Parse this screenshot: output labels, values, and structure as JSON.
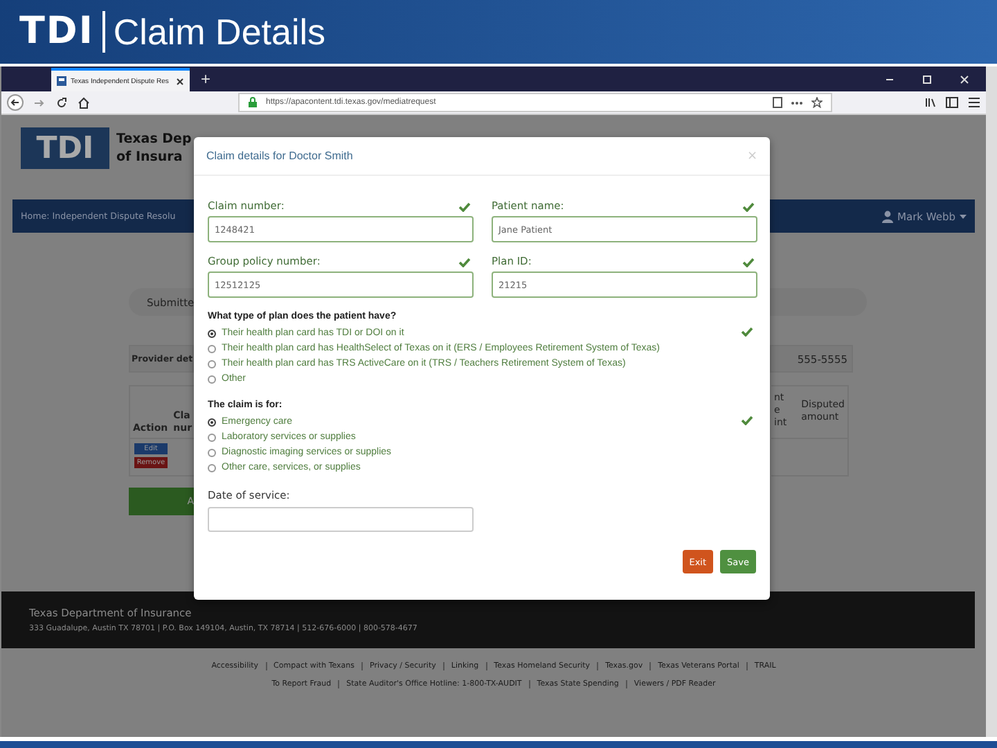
{
  "slide": {
    "logo": "TDI",
    "title": "Claim Details"
  },
  "browser": {
    "tab_title": "Texas Independent Dispute Res",
    "new_tab": "+",
    "url": "https://apacontent.tdi.texas.gov/mediatrequest"
  },
  "page": {
    "logo": "TDI",
    "org_name_lines": [
      "Texas Dep",
      "of Insura"
    ],
    "nav": {
      "breadcrumb": "Home: Independent Dispute Resolu",
      "user": "Mark Webb"
    },
    "submitted_button": "Submitte",
    "provider_label": "Provider det",
    "phone": "555-5555",
    "table": {
      "columns_left": [
        {
          "lines": [
            "Action"
          ]
        },
        {
          "lines": [
            "Cla",
            "nur"
          ]
        }
      ],
      "columns_right": [
        {
          "lines": [
            "nt",
            "e",
            "int"
          ]
        },
        {
          "lines": [
            "Disputed",
            "amount"
          ]
        }
      ],
      "row_buttons": [
        {
          "label": "Edit",
          "kind": "edit"
        },
        {
          "label": "Remove",
          "kind": "remove"
        }
      ]
    },
    "add_button": "A"
  },
  "modal": {
    "title": "Claim details for Doctor Smith",
    "close": "×",
    "fields": [
      {
        "label": "Claim number:",
        "value": "1248421",
        "valid": true
      },
      {
        "label": "Patient name:",
        "value": "Jane Patient",
        "valid": true
      },
      {
        "label": "Group policy number:",
        "value": "12512125",
        "valid": true
      },
      {
        "label": "Plan ID:",
        "value": "21215",
        "valid": true
      }
    ],
    "radio_groups": [
      {
        "label": "What type of plan does the patient have?",
        "valid": true,
        "options": [
          {
            "label": "Their health plan card has TDI or DOI on it",
            "selected": true
          },
          {
            "label": "Their health plan card has HealthSelect of Texas on it (ERS / Employees Retirement System of Texas)",
            "selected": false
          },
          {
            "label": "Their health plan card has TRS ActiveCare on it (TRS / Teachers Retirement System of Texas)",
            "selected": false
          },
          {
            "label": "Other",
            "selected": false
          }
        ]
      },
      {
        "label": "The claim is for:",
        "valid": true,
        "options": [
          {
            "label": "Emergency care",
            "selected": true
          },
          {
            "label": "Laboratory services or supplies",
            "selected": false
          },
          {
            "label": "Diagnostic imaging services or supplies",
            "selected": false
          },
          {
            "label": "Other care, services, or supplies",
            "selected": false
          }
        ]
      }
    ],
    "date_field": {
      "label": "Date of service:",
      "valid": false
    },
    "buttons": [
      {
        "label": "Exit",
        "kind": "exit"
      },
      {
        "label": "Save",
        "kind": "save"
      }
    ]
  },
  "footer": {
    "org": "Texas Department of Insurance",
    "address": "333 Guadalupe, Austin TX 78701 | P.O. Box 149104, Austin, TX 78714 | 512-676-6000 | 800-578-4677",
    "link_rows": [
      [
        "Accessibility",
        "Compact with Texans",
        "Privacy / Security",
        "Linking",
        "Texas Homeland Security",
        "Texas.gov",
        "Texas Veterans Portal",
        "TRAIL"
      ],
      [
        "To Report Fraud",
        "State Auditor's Office Hotline: 1-800-TX-AUDIT",
        "Texas State Spending",
        "Viewers / PDF Reader"
      ]
    ]
  }
}
